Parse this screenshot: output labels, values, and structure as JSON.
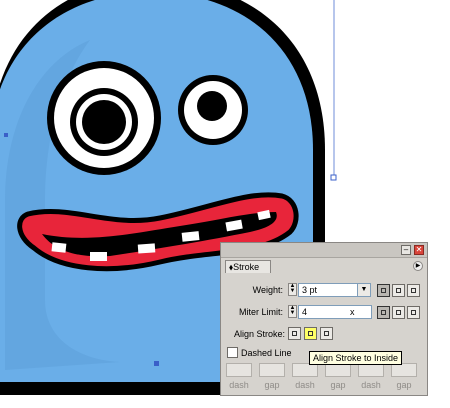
{
  "stroke_panel": {
    "tab_label": "Stroke",
    "weight_label": "Weight:",
    "weight_value": "3 pt",
    "miter_label": "Miter Limit:",
    "miter_value": "4",
    "miter_unit": "x",
    "align_label": "Align Stroke:",
    "dashed_label": "Dashed Line",
    "dash_labels": [
      "dash",
      "gap",
      "dash",
      "gap",
      "dash",
      "gap"
    ],
    "tooltip": "Align Stroke to Inside"
  },
  "colors": {
    "monster_body": "#6aaee8",
    "outline": "#000000",
    "mouth": "#e8253a",
    "highlight": "#ffff66"
  }
}
